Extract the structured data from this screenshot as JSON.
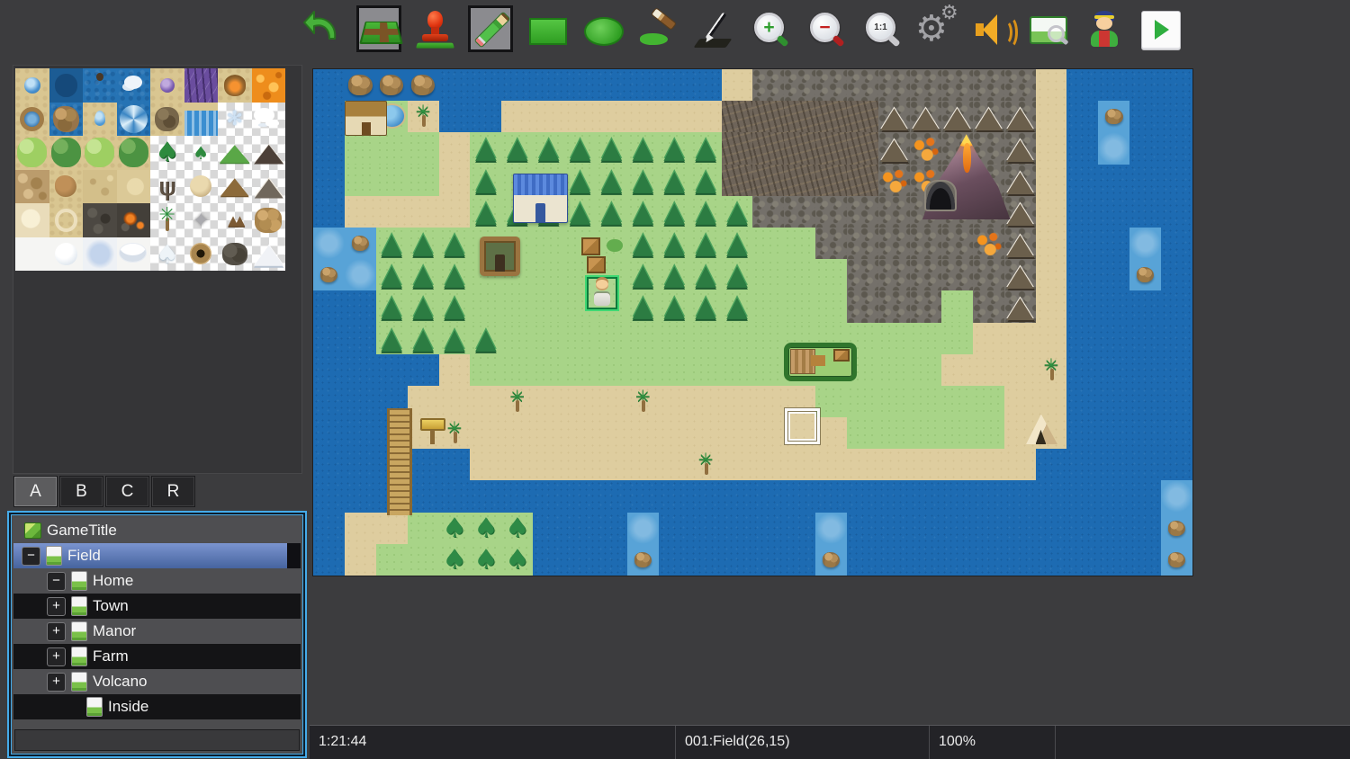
{
  "colors": {
    "accent_blue": "#45abe9",
    "selection_green": "#3fd873",
    "tree_selected_blue": "#5b79b8",
    "background": "#3c3c3e",
    "water": "#1d6bb2",
    "grass": "#a8d488",
    "sand": "#decd9f"
  },
  "toolbar": {
    "tools": [
      {
        "name": "undo",
        "selected": false
      },
      {
        "name": "map-mode",
        "selected": true
      },
      {
        "name": "event-mode",
        "selected": false
      },
      {
        "name": "pencil",
        "selected": true
      },
      {
        "name": "rectangle",
        "selected": false
      },
      {
        "name": "ellipse",
        "selected": false
      },
      {
        "name": "flood-fill",
        "selected": false
      },
      {
        "name": "shadow-pen",
        "selected": false
      },
      {
        "name": "zoom-in",
        "selected": false
      },
      {
        "name": "zoom-out",
        "selected": false
      },
      {
        "name": "zoom-actual",
        "selected": false
      },
      {
        "name": "settings",
        "selected": false
      },
      {
        "name": "sound-test",
        "selected": false
      },
      {
        "name": "search",
        "selected": false
      },
      {
        "name": "character",
        "selected": false
      },
      {
        "name": "playtest",
        "selected": false
      }
    ]
  },
  "palette": {
    "tabs": [
      {
        "label": "A",
        "selected": true
      },
      {
        "label": "B",
        "selected": false
      },
      {
        "label": "C",
        "selected": false
      },
      {
        "label": "R",
        "selected": false
      }
    ],
    "tiles": [
      "sand-dot-blue",
      "water-dark",
      "water-bird",
      "water-cloud",
      "sand-dot-purple",
      "purple-trees",
      "sand-fire",
      "lava",
      "sand-rock-ring",
      "water-rocks",
      "sand-drop",
      "water-whirl",
      "sand-rocks",
      "waterfall",
      "snow-flake",
      "clouds",
      "bush-light",
      "bush-dark",
      "bush-light2",
      "bush-dark2",
      "tree",
      "tree-small",
      "hill-green",
      "mountain-dark",
      "pebbles",
      "dirt-patch",
      "sand-rough",
      "sand-plain",
      "tree-dead",
      "sand-mound",
      "hill-brown",
      "mountain-gray",
      "sand-pale",
      "sand-ring",
      "rocks-dark",
      "rocks-lava",
      "palm",
      "spark-gray",
      "rocks-brown",
      "boulders",
      "white",
      "snow-mound",
      "blue-pale",
      "cloud-big",
      "tree-snow",
      "sand-hole",
      "rocks-dark2",
      "mountain-snow"
    ]
  },
  "map_tree": {
    "items": [
      {
        "label": "GameTitle",
        "level": 0,
        "icon": "cube",
        "toggle": null,
        "selected": false,
        "shade": "gray"
      },
      {
        "label": "Field",
        "level": 1,
        "icon": "map",
        "toggle": "minus",
        "selected": true,
        "shade": "sel"
      },
      {
        "label": "Home",
        "level": 2,
        "icon": "map",
        "toggle": "minus",
        "selected": false,
        "shade": "gray"
      },
      {
        "label": "Town",
        "level": 2,
        "icon": "map",
        "toggle": "plus",
        "selected": false,
        "shade": "dark"
      },
      {
        "label": "Manor",
        "level": 2,
        "icon": "map",
        "toggle": "plus",
        "selected": false,
        "shade": "gray"
      },
      {
        "label": "Farm",
        "level": 2,
        "icon": "map",
        "toggle": "plus",
        "selected": false,
        "shade": "dark"
      },
      {
        "label": "Volcano",
        "level": 2,
        "icon": "map",
        "toggle": "plus",
        "selected": false,
        "shade": "gray"
      },
      {
        "label": "Inside",
        "level": 3,
        "icon": "map",
        "toggle": null,
        "selected": false,
        "shade": "dark"
      }
    ]
  },
  "status_bar": {
    "cells": [
      {
        "text": "1:21:44"
      },
      {
        "text": "001:Field(26,15)"
      },
      {
        "text": "100%"
      },
      {
        "text": ""
      }
    ]
  },
  "map": {
    "cols": 28,
    "rows": 16,
    "legend": {
      "W": "deep-water",
      "w": "shallow-water",
      "S": "sand",
      "G": "grass",
      "F": "pine-tree",
      "T": "leafy-tree",
      "D": "dead-forest",
      "R": "rocky-ground",
      "M": "mountain",
      "L": "lava",
      "K": "rocks-in-water",
      "k": "rocks-in-shallow",
      "p": "palm-tree",
      "O": "pond"
    },
    "grid": [
      "WKKKWWWWWWWWWSRRRRRRRRRSWWWW",
      "WGOpWWSSSSSSSDDDDDMMMMMSWkWW",
      "WGGGSFFFFFFFFDDDDDMLRRMSWwWW",
      "WGGGSFGGFFFFFDDDDDLLRRMSWWWW",
      "WSSSSFFFFFFFFFRRRRRRRRMSWWWW",
      "wkFFFGGGGGFFFFGGRRRRRLMSWWwW",
      "kwFFFGGGGGFFFFGGGRRRRRMSWWkW",
      "WWFFFGGGGGFFFFGGGRRRGRMSWWWW",
      "WWFFFFGGGGGGGGGGGGGGGSSSWWWW",
      "WWWWSGGGGGGGGGGGGGGGSSSpWWWW",
      "WWWSSSpSSSpSSSSSGGGGGGSSWWWW",
      "WWWSpSSSSSSSSSSSSGGGGGSSWWWW",
      "WWWWWSSSSSSSpSSSSSSSSSSWWWWW",
      "WWWWWWWWWWWWWWWWWWWWWWWWWWWw",
      "WSSGTTTWWWwWWWWWwWWWWWWWWWWk",
      "WSGGTTTWWWkWWWWWkWWWWWWWWWWk"
    ],
    "overlays": [
      {
        "type": "house-small",
        "c": 1.0,
        "r": 1.0,
        "w": 1.35,
        "h": 1.1
      },
      {
        "type": "house-blue",
        "c": 6.35,
        "r": 3.3,
        "w": 1.75,
        "h": 1.55
      },
      {
        "type": "volcano",
        "c": 19.4,
        "r": 2.0,
        "w": 2.8,
        "h": 2.75
      },
      {
        "type": "cave",
        "c": 19.45,
        "r": 3.5,
        "w": 1.05,
        "h": 1.0
      },
      {
        "type": "fort",
        "c": 5.3,
        "r": 5.3,
        "w": 1.3,
        "h": 1.25
      },
      {
        "type": "crates",
        "c": 8.55,
        "r": 5.25,
        "w": 1.3,
        "h": 1.25
      },
      {
        "type": "actor",
        "c": 8.65,
        "r": 6.5,
        "w": 1.1,
        "h": 1.15
      },
      {
        "type": "farm",
        "c": 15.0,
        "r": 8.65,
        "w": 2.3,
        "h": 1.2
      },
      {
        "type": "bridge",
        "c": 2.35,
        "r": 10.7,
        "w": 0.8,
        "h": 3.4
      },
      {
        "type": "sign",
        "c": 3.4,
        "r": 10.95,
        "w": 0.8,
        "h": 0.9
      },
      {
        "type": "cursor",
        "c": 15.02,
        "r": 10.72,
        "w": 1.12,
        "h": 1.12
      },
      {
        "type": "tent",
        "c": 22.7,
        "r": 10.9,
        "w": 1.0,
        "h": 0.95
      }
    ]
  }
}
